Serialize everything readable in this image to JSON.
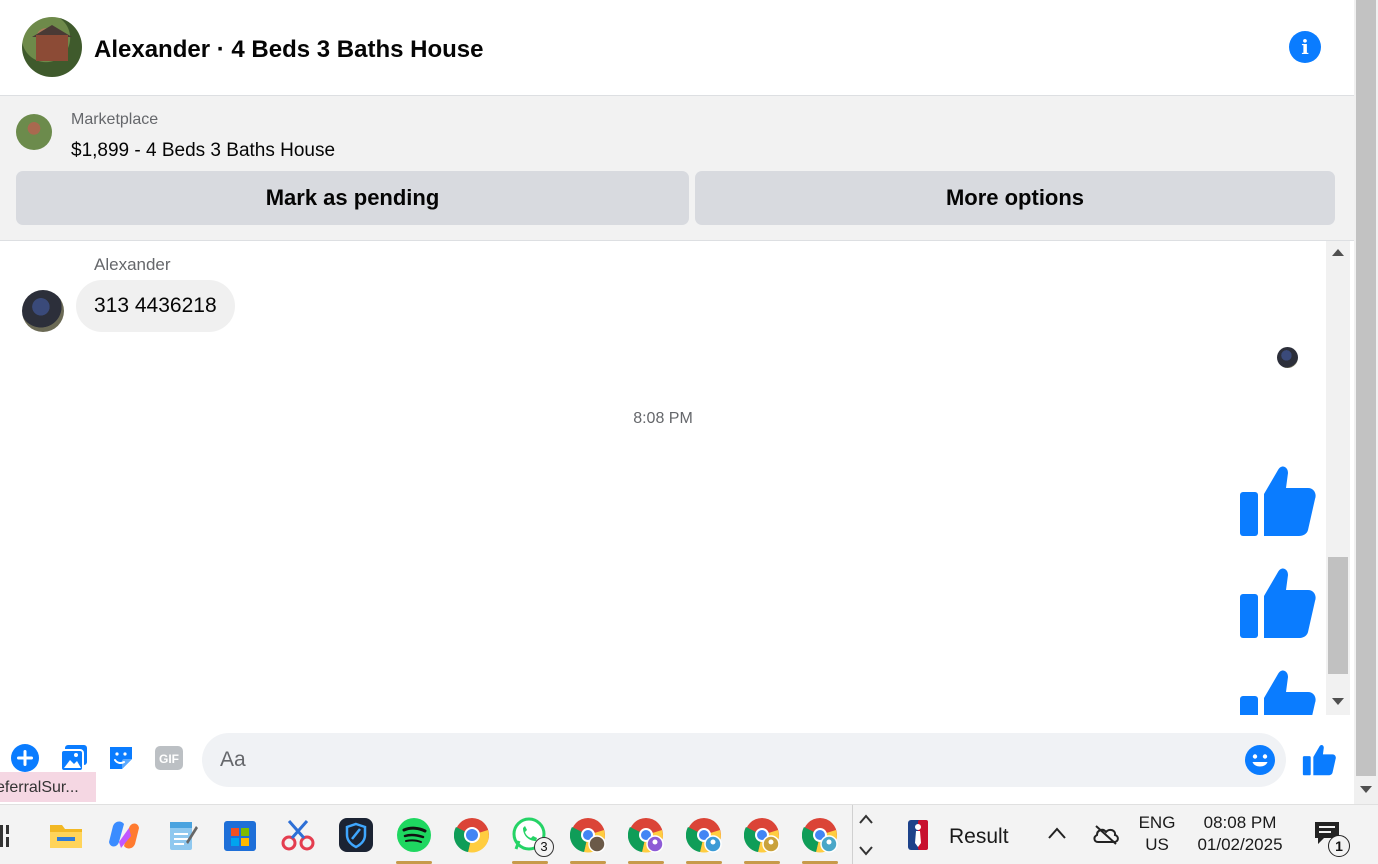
{
  "header": {
    "title": "Alexander · 4 Beds 3 Baths House",
    "info_icon": "info-icon"
  },
  "marketplace": {
    "label": "Marketplace",
    "listing": "$1,899 - 4 Beds 3 Baths House",
    "mark_pending_label": "Mark as pending",
    "more_options_label": "More options"
  },
  "conversation": {
    "sender_name": "Alexander",
    "message_text": "313 4436218",
    "timestamp": "8:08 PM",
    "like_color": "#0a7cff"
  },
  "composer": {
    "placeholder": "Aa",
    "icons": [
      "plus-icon",
      "photo-icon",
      "sticker-icon",
      "gif-icon",
      "emoji-icon",
      "like-icon"
    ],
    "gif_label": "GIF"
  },
  "tooltip_tab": {
    "text": "eferralSur..."
  },
  "taskbar": {
    "pinned_apps": [
      "file-explorer-icon",
      "copilot-icon",
      "notepad-icon",
      "store-icon",
      "snipping-tool-icon",
      "vpn-shield-icon",
      "spotify-icon",
      "chrome-icon",
      "whatsapp-icon",
      "chrome-profile-icon"
    ],
    "whatsapp_badge": "3",
    "widget_text": "Result",
    "lang_top": "ENG",
    "lang_bottom": "US",
    "time": "08:08 PM",
    "date": "01/02/2025",
    "notification_count": "1"
  }
}
